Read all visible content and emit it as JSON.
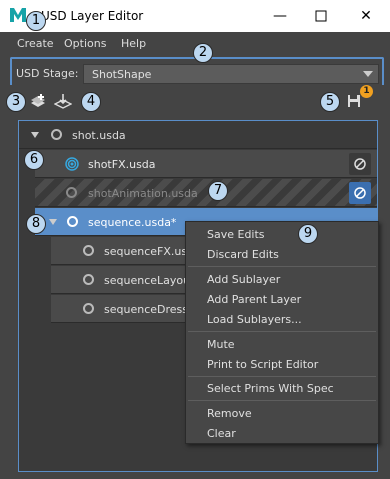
{
  "window": {
    "title": "USD Layer Editor"
  },
  "menu": [
    "Create",
    "Options",
    "Help"
  ],
  "stage": {
    "label": "USD Stage:",
    "value": "ShotShape"
  },
  "save_notification_count": "1",
  "layers": [
    {
      "name": "shot.usda"
    },
    {
      "name": "shotFX.usda"
    },
    {
      "name": "shotAnimation.usda"
    },
    {
      "name": "sequence.usda*"
    },
    {
      "name": "sequenceFX.usda"
    },
    {
      "name": "sequenceLayout"
    },
    {
      "name": "sequenceDress"
    }
  ],
  "context_menu": {
    "items": [
      "Save Edits",
      "Discard Edits",
      "Add Sublayer",
      "Add Parent Layer",
      "Load Sublayers...",
      "Mute",
      "Print to Script Editor",
      "Select Prims With Spec",
      "Remove",
      "Clear"
    ]
  },
  "callouts": [
    "1",
    "2",
    "3",
    "4",
    "5",
    "6",
    "7",
    "8",
    "9"
  ],
  "colors": {
    "panel_bg": "#444444",
    "selection": "#5a8ec9",
    "accent_badge": "#bcd7f0",
    "notification": "#f0a020"
  }
}
